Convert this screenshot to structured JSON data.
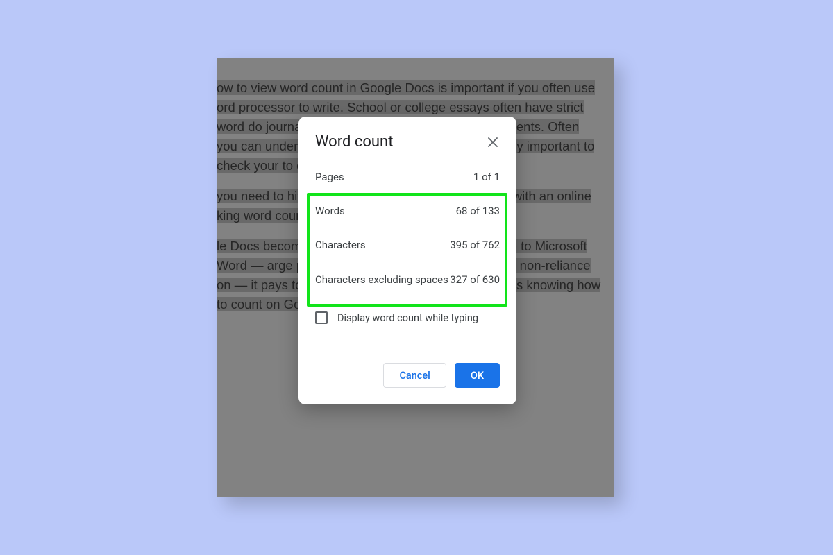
{
  "document": {
    "para1": "ow to view word count in Google Docs is important if you often use ord processor to write. School or college essays often have strict word do journalistic and professional writing assignments. Often you can under nor over a word count, so it's incredibly important to check your to ensure you're falling within your limits.",
    "para2": "you need to hit a specific word count or are working with an online king word count is essential.",
    "para3": "le Docs becoming an increasingly popular alternative to Microsoft Word — arge part to its collaborative features and its non-reliance on — it pays to way around the app, and that includes knowing how to count on Google"
  },
  "dialog": {
    "title": "Word count",
    "stats": {
      "pages_label": "Pages",
      "pages_value": "1 of 1",
      "words_label": "Words",
      "words_value": "68 of 133",
      "chars_label": "Characters",
      "chars_value": "395 of 762",
      "chars_ex_label": "Characters excluding spaces",
      "chars_ex_value": "327 of 630"
    },
    "checkbox_label": "Display word count while typing",
    "buttons": {
      "cancel": "Cancel",
      "ok": "OK"
    }
  }
}
